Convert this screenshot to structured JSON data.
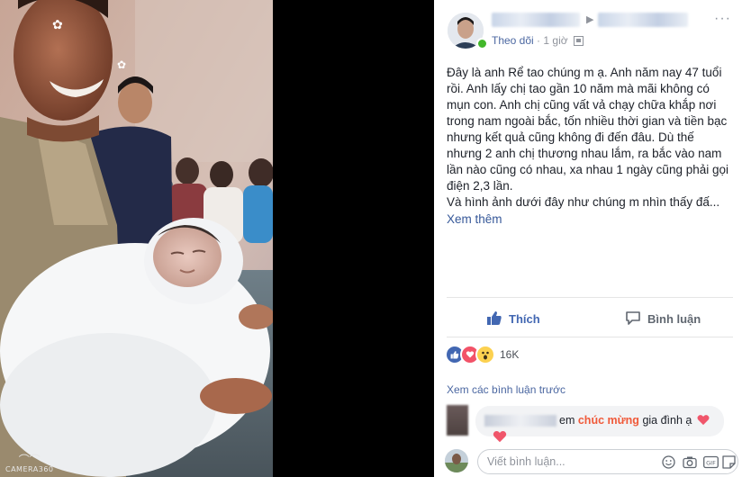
{
  "photo": {
    "watermark": "CAMERA360"
  },
  "post": {
    "meta": {
      "follow_label": "Theo dõi",
      "separator": "·",
      "time": "1 giờ"
    },
    "text_lines": [
      "Đây là anh Rể tao chúng m ạ. Anh năm nay 47 tuổi",
      "rồi. Anh lấy chị tao gần 10 năm mà mãi không có",
      "mụn con. Anh chị cũng vất vả chạy chữa khắp nơi",
      "trong nam ngoài bắc, tốn nhiều thời gian và tiền bạc",
      "nhưng kết quả cũng không đi đến đâu. Dù thế",
      "nhưng 2 anh chị thương nhau lắm, ra bắc vào nam",
      "lần nào cũng có nhau, xa nhau 1 ngày cũng phải gọi",
      "điện 2,3 lần.",
      "Và hình ảnh dưới đây như chúng m nhìn thấy đấ..."
    ],
    "see_more": "Xem thêm",
    "like_label": "Thích",
    "comment_label": "Bình luận",
    "reaction_count": "16K",
    "previous_comments": "Xem các bình luận trước",
    "comment": {
      "before": "em",
      "highlight": "chúc mừng",
      "after": "gia đình ạ"
    },
    "composer_placeholder": "Viết bình luận...",
    "colors": {
      "link": "#365899",
      "like_blue": "#4267b2",
      "highlight": "#f05a3a",
      "online": "#42b72a"
    },
    "icons": [
      "more-dots-icon",
      "globe-icon",
      "like-thumb-icon",
      "comment-bubble-icon",
      "like-reaction-icon",
      "love-reaction-icon",
      "wow-reaction-icon",
      "heart-icon",
      "emoji-icon",
      "camera-icon",
      "gif-icon",
      "sticker-icon"
    ]
  }
}
